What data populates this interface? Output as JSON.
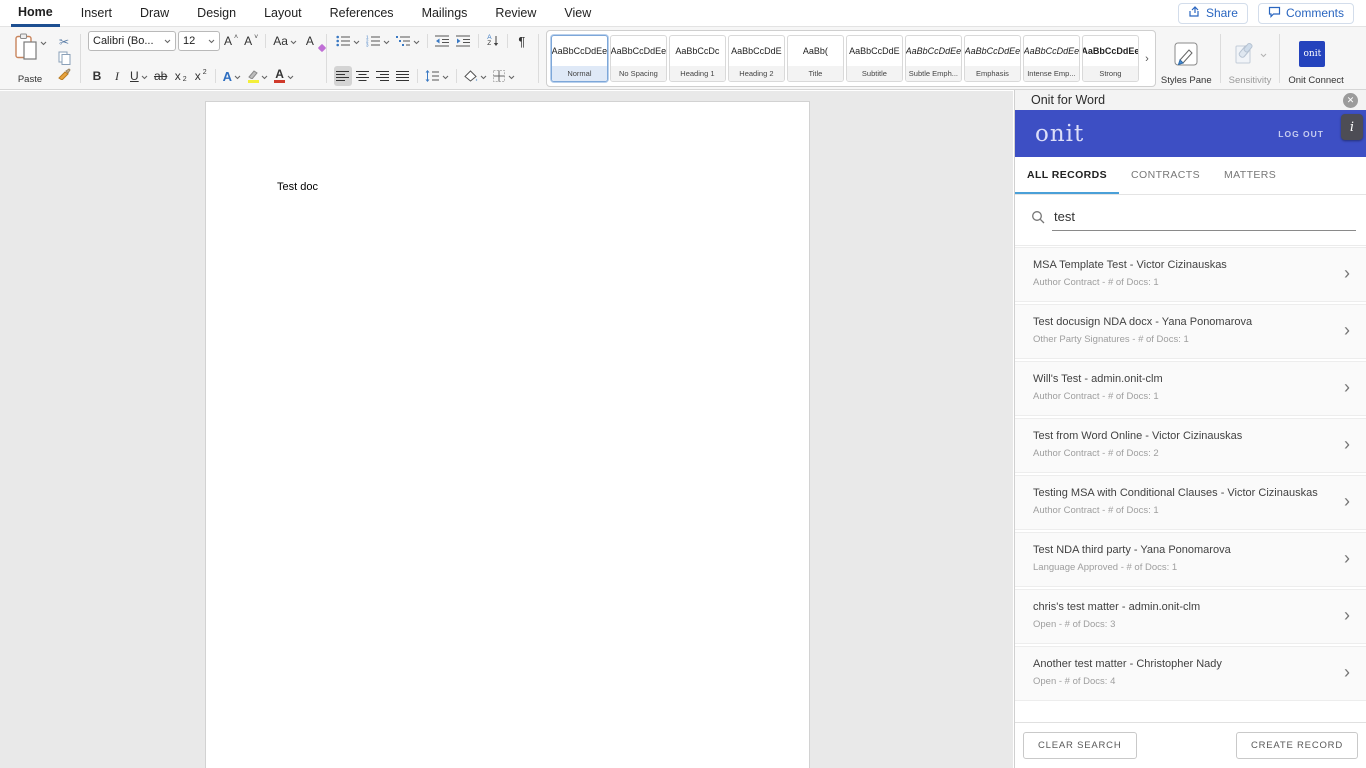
{
  "menu": {
    "tabs": [
      {
        "label": "Home"
      },
      {
        "label": "Insert"
      },
      {
        "label": "Draw"
      },
      {
        "label": "Design"
      },
      {
        "label": "Layout"
      },
      {
        "label": "References"
      },
      {
        "label": "Mailings"
      },
      {
        "label": "Review"
      },
      {
        "label": "View"
      }
    ],
    "active_tab": "Home",
    "share_label": "Share",
    "comments_label": "Comments"
  },
  "ribbon": {
    "paste_label": "Paste",
    "font_name": "Calibri (Bo...",
    "font_size": "12",
    "icons": {
      "grow_font": "A",
      "shrink_font": "A",
      "change_case": "Aa",
      "clear_format": "A",
      "bold": "B",
      "italic": "I",
      "underline": "U",
      "strikethrough": "ab",
      "subscript_base": "x",
      "subscript_script": "2",
      "superscript_base": "x",
      "superscript_script": "2",
      "text_effects": "A",
      "font_color": "A",
      "pilcrow": "¶",
      "sort_a": "A",
      "sort_z": "Z"
    },
    "styles": [
      {
        "preview": "AaBbCcDdEe",
        "label": "Normal",
        "selected": true
      },
      {
        "preview": "AaBbCcDdEe",
        "label": "No Spacing"
      },
      {
        "preview": "AaBbCcDc",
        "label": "Heading 1"
      },
      {
        "preview": "AaBbCcDdE",
        "label": "Heading 2"
      },
      {
        "preview": "AaBb(",
        "label": "Title"
      },
      {
        "preview": "AaBbCcDdE",
        "label": "Subtitle"
      },
      {
        "preview": "AaBbCcDdEe",
        "label": "Subtle Emph..."
      },
      {
        "preview": "AaBbCcDdEe",
        "label": "Emphasis"
      },
      {
        "preview": "AaBbCcDdEe",
        "label": "Intense Emp..."
      },
      {
        "preview": "AaBbCcDdEe",
        "label": "Strong"
      }
    ],
    "gallery_expander": "›",
    "styles_pane_label": "Styles Pane",
    "sensitivity_label": "Sensitivity",
    "onit_connect_label": "Onit Connect",
    "onit_connect_logo": "onit"
  },
  "document": {
    "text": "Test doc"
  },
  "panel": {
    "title": "Onit for Word",
    "close_icon": "✕",
    "logo": "onit",
    "logout_label": "LOG OUT",
    "info_icon": "i",
    "tabs": [
      {
        "label": "ALL RECORDS",
        "active": true
      },
      {
        "label": "CONTRACTS",
        "active": false
      },
      {
        "label": "MATTERS",
        "active": false
      }
    ],
    "search": {
      "value": "test"
    },
    "records": [
      {
        "title": "MSA Template Test - Victor Cizinauskas",
        "subtitle": "Author Contract - # of Docs: 1",
        "chevron": "›"
      },
      {
        "title": "Test docusign NDA docx - Yana Ponomarova",
        "subtitle": "Other Party Signatures - # of Docs: 1",
        "chevron": "›"
      },
      {
        "title": "Will's Test - admin.onit-clm",
        "subtitle": "Author Contract - # of Docs: 1",
        "chevron": "›"
      },
      {
        "title": "Test from Word Online - Victor Cizinauskas",
        "subtitle": "Author Contract - # of Docs: 2",
        "chevron": "›"
      },
      {
        "title": "Testing MSA with Conditional Clauses - Victor Cizinauskas",
        "subtitle": "Author Contract - # of Docs: 1",
        "chevron": "›"
      },
      {
        "title": "Test NDA third party - Yana Ponomarova",
        "subtitle": "Language Approved - # of Docs: 1",
        "chevron": "›"
      },
      {
        "title": "chris's test matter - admin.onit-clm",
        "subtitle": "Open - # of Docs: 3",
        "chevron": "›"
      },
      {
        "title": "Another test matter - Christopher Nady",
        "subtitle": "Open - # of Docs: 4",
        "chevron": "›"
      }
    ],
    "footer": {
      "clear_label": "CLEAR SEARCH",
      "create_label": "CREATE RECORD"
    }
  },
  "colors": {
    "banner_blue": "#3d4fc4",
    "tab_underline_blue": "#4aa0d8",
    "home_underline_blue": "#1d4f91",
    "share_comment_blue": "#2a66c0",
    "onit_square_blue": "#2443bd",
    "heading_blue": "#2e5b9f",
    "row_background": "#fafafa",
    "ribbon_background": "#f6f6f6"
  }
}
